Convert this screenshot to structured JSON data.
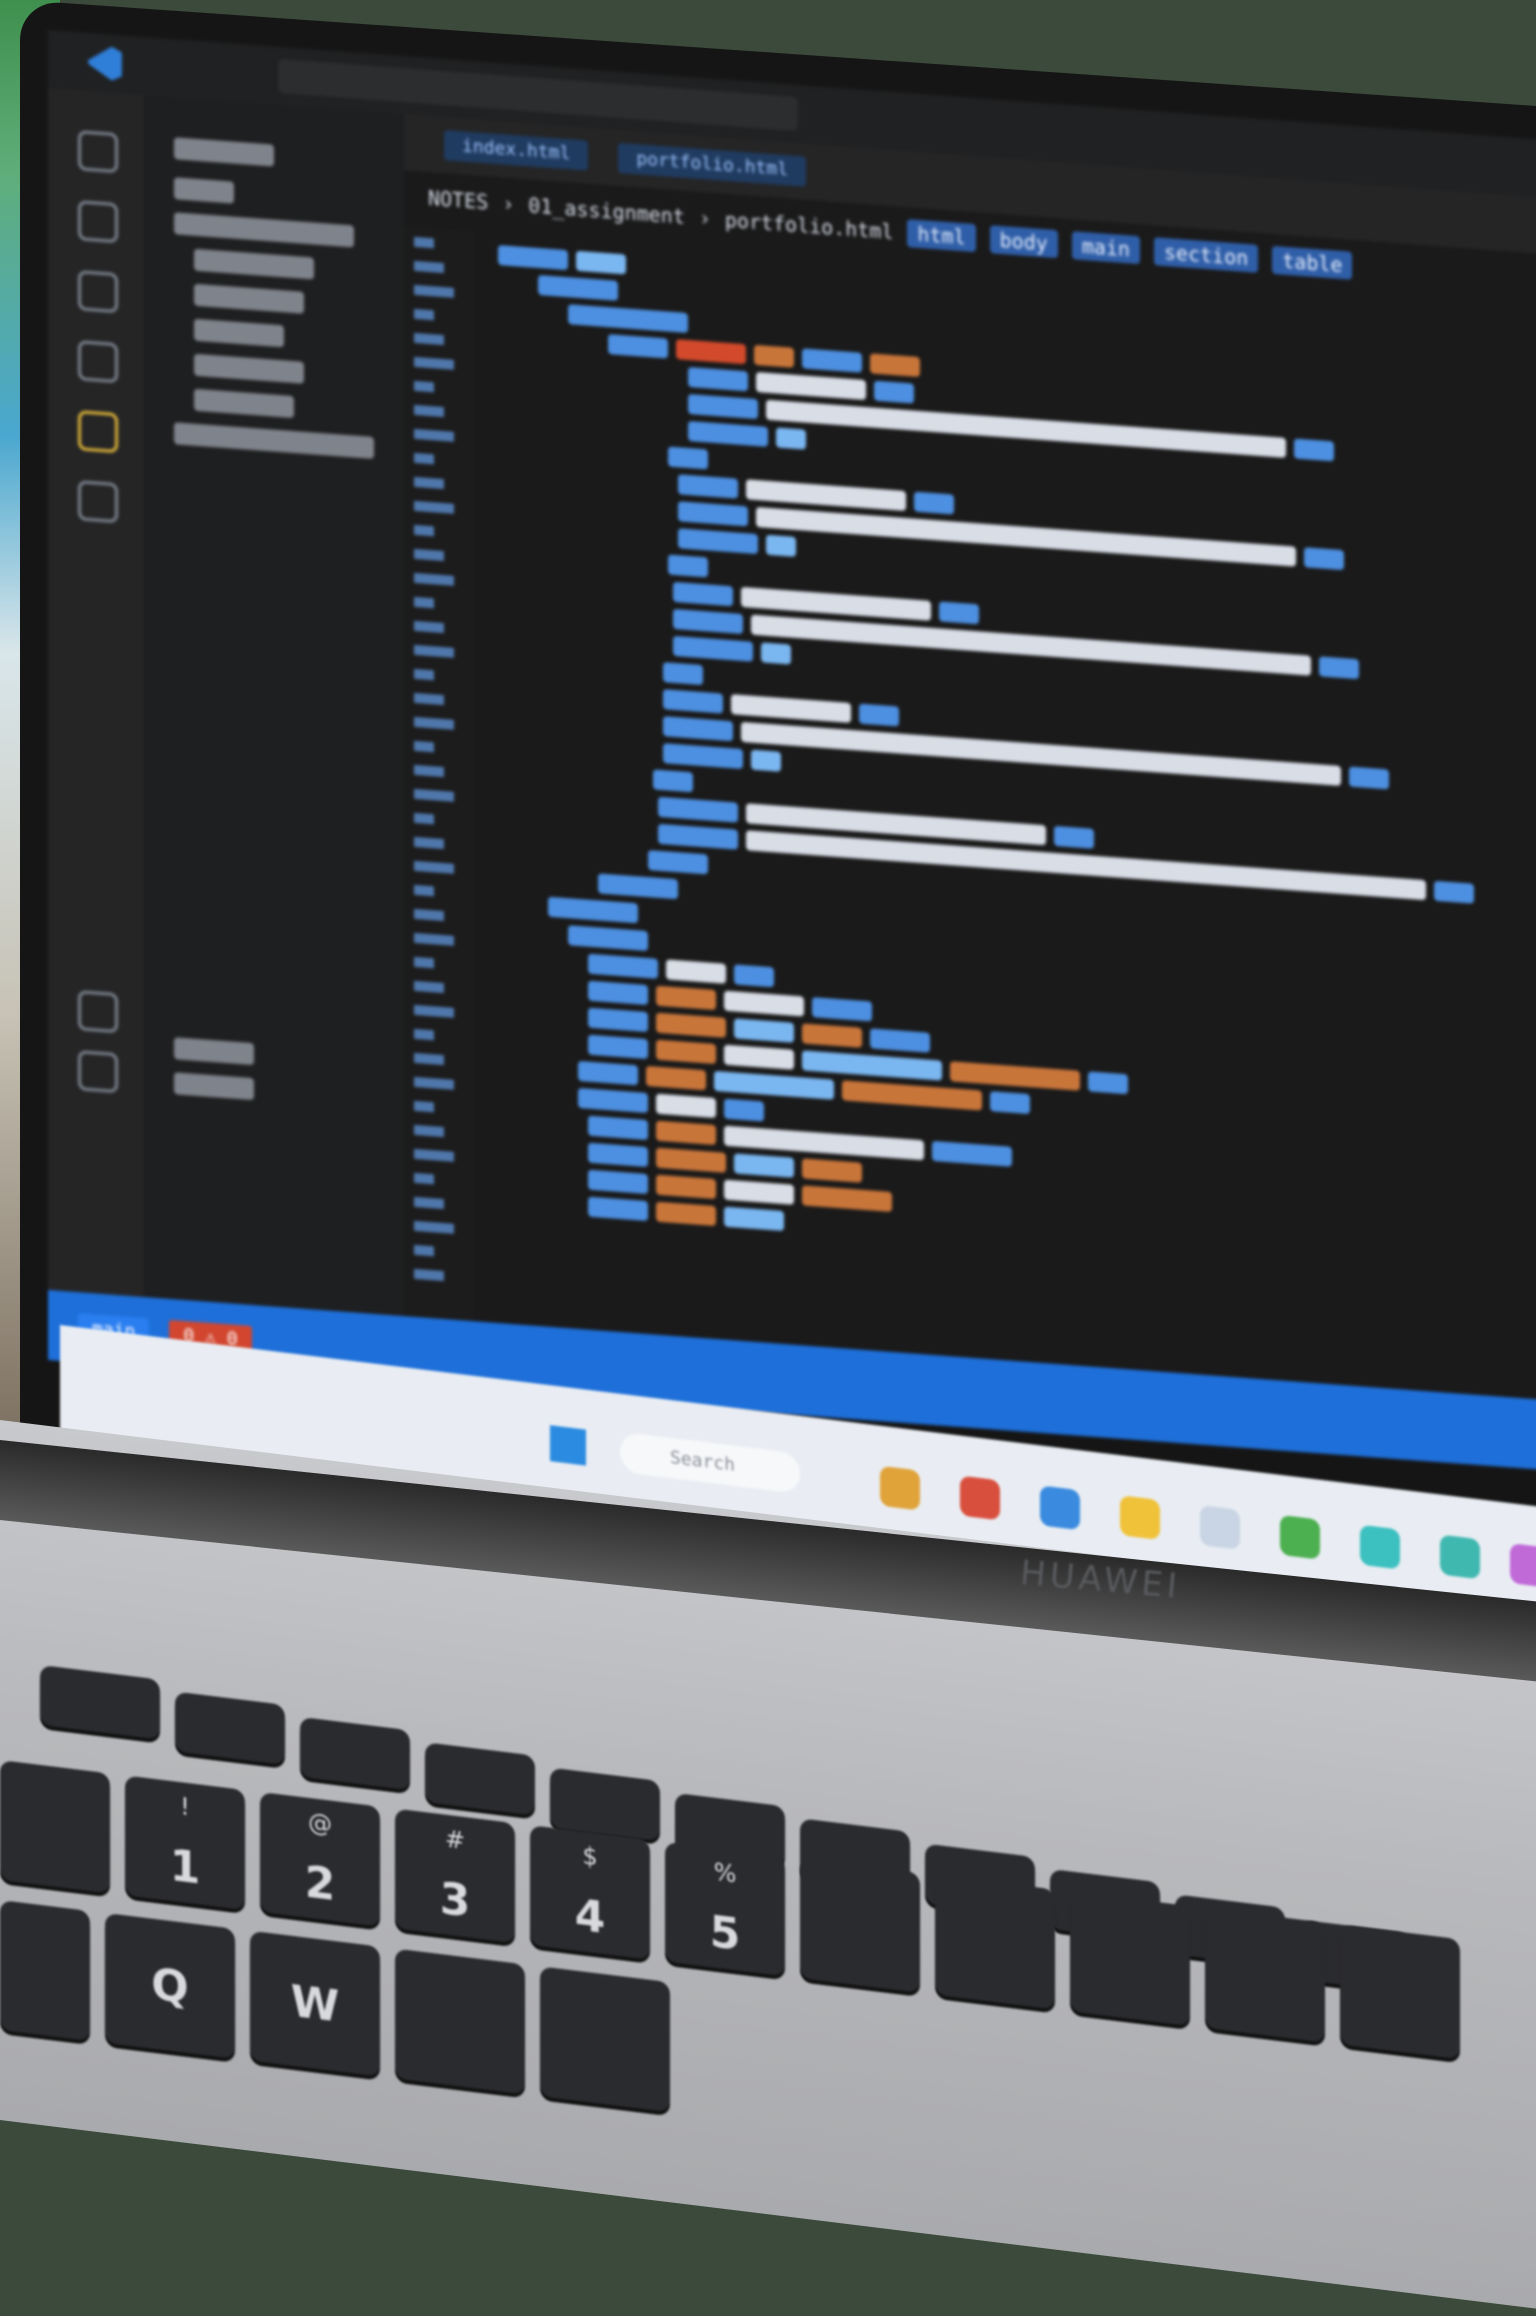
{
  "editor": {
    "breadcrumb": [
      "NOTES",
      "01_assignment",
      "portfolio.html",
      "html",
      "body",
      "main",
      "section",
      "table"
    ],
    "tabs": [
      "index.html",
      "portfolio.html"
    ],
    "status": [
      "main",
      "0 ⚠ 0"
    ]
  },
  "taskbar": {
    "search_placeholder": "Search"
  },
  "laptop": {
    "brand": "HUAWEI"
  },
  "keyboard": {
    "row1": [
      {
        "main": "!",
        "sub": "1"
      },
      {
        "main": "@",
        "sub": "2"
      },
      {
        "main": "#",
        "sub": "3"
      },
      {
        "main": "$",
        "sub": "4"
      },
      {
        "main": "%",
        "sub": "5"
      }
    ],
    "row2": [
      "Q",
      "W"
    ]
  }
}
